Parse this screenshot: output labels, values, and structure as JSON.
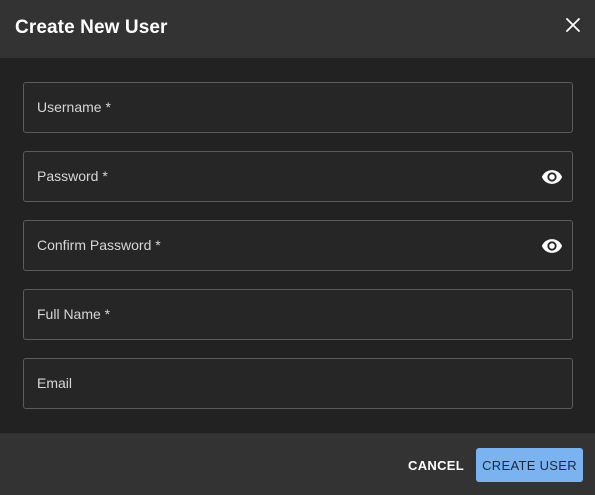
{
  "dialog": {
    "title": "Create New User",
    "close_icon": "close-icon"
  },
  "form": {
    "username": {
      "label": "Username *",
      "value": ""
    },
    "password": {
      "label": "Password *",
      "value": "",
      "toggle_icon": "eye-icon"
    },
    "confirm_password": {
      "label": "Confirm Password *",
      "value": "",
      "toggle_icon": "eye-icon"
    },
    "full_name": {
      "label": "Full Name *",
      "value": ""
    },
    "email": {
      "label": "Email",
      "value": ""
    }
  },
  "footer": {
    "cancel_label": "CANCEL",
    "create_label": "CREATE USER"
  },
  "colors": {
    "primary_button": "#7ab3f0",
    "header_background": "#333333",
    "body_background": "#222222",
    "field_border": "#5b5b5b"
  }
}
